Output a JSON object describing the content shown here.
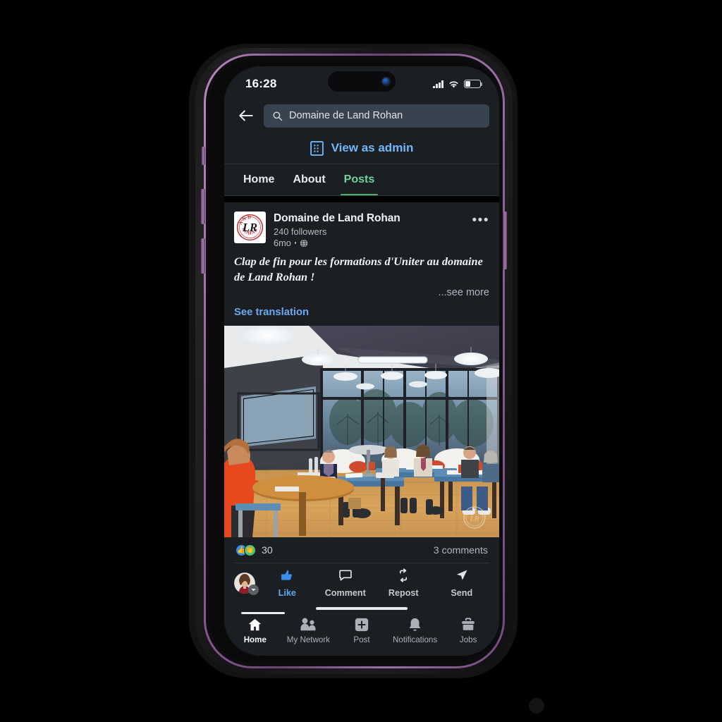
{
  "device": {
    "frame_color": "#8d5f96",
    "body_color": "#1a1a1c"
  },
  "status_bar": {
    "time": "16:28",
    "signal_icon": "cellular-signal-icon",
    "wifi_icon": "wifi-icon",
    "battery_icon": "battery-icon"
  },
  "search": {
    "back_icon": "back-arrow-icon",
    "search_icon": "search-icon",
    "value": "Domaine de Land Rohan",
    "placeholder": "Search"
  },
  "admin_bar": {
    "icon": "building-icon",
    "label": "View as admin",
    "color": "#71b7f7"
  },
  "tabs": [
    {
      "label": "Home",
      "active": false
    },
    {
      "label": "About",
      "active": false
    },
    {
      "label": "Posts",
      "active": true
    }
  ],
  "tab_active_color": "#6fd39b",
  "post": {
    "logo": {
      "icon": "company-logo-icon",
      "top_text": "LAND",
      "bottom_text": "ROHAN",
      "monogram": "LR",
      "seal_color": "#c1272d"
    },
    "author": "Domaine de Land Rohan",
    "followers": "240 followers",
    "time": "6mo",
    "visibility_icon": "globe-icon",
    "menu_icon": "kebab-menu-icon",
    "text": "Clap de fin pour les formations d'Uniter au domaine de Land Rohan !",
    "see_more": "...see more",
    "see_translation": "See translation",
    "image": {
      "alt_icon": "meeting-room-photo",
      "watermark": "land-rohan-watermark"
    },
    "reactions": {
      "like_icon": "thumbs-up-reaction-icon",
      "clap_icon": "clap-reaction-icon",
      "count": "30",
      "comments": "3 comments"
    },
    "actions": [
      {
        "label": "Like",
        "icon": "thumbs-up-icon",
        "active": true
      },
      {
        "label": "Comment",
        "icon": "comment-icon",
        "active": false
      },
      {
        "label": "Repost",
        "icon": "repost-icon",
        "active": false
      },
      {
        "label": "Send",
        "icon": "send-icon",
        "active": false
      }
    ],
    "avatar_icon": "user-avatar",
    "avatar_chevron_icon": "chevron-down-icon"
  },
  "bottom_nav": [
    {
      "label": "Home",
      "icon": "home-icon",
      "active": true
    },
    {
      "label": "My Network",
      "icon": "network-icon",
      "active": false
    },
    {
      "label": "Post",
      "icon": "plus-square-icon",
      "active": false
    },
    {
      "label": "Notifications",
      "icon": "bell-icon",
      "active": false
    },
    {
      "label": "Jobs",
      "icon": "briefcase-icon",
      "active": false
    }
  ]
}
